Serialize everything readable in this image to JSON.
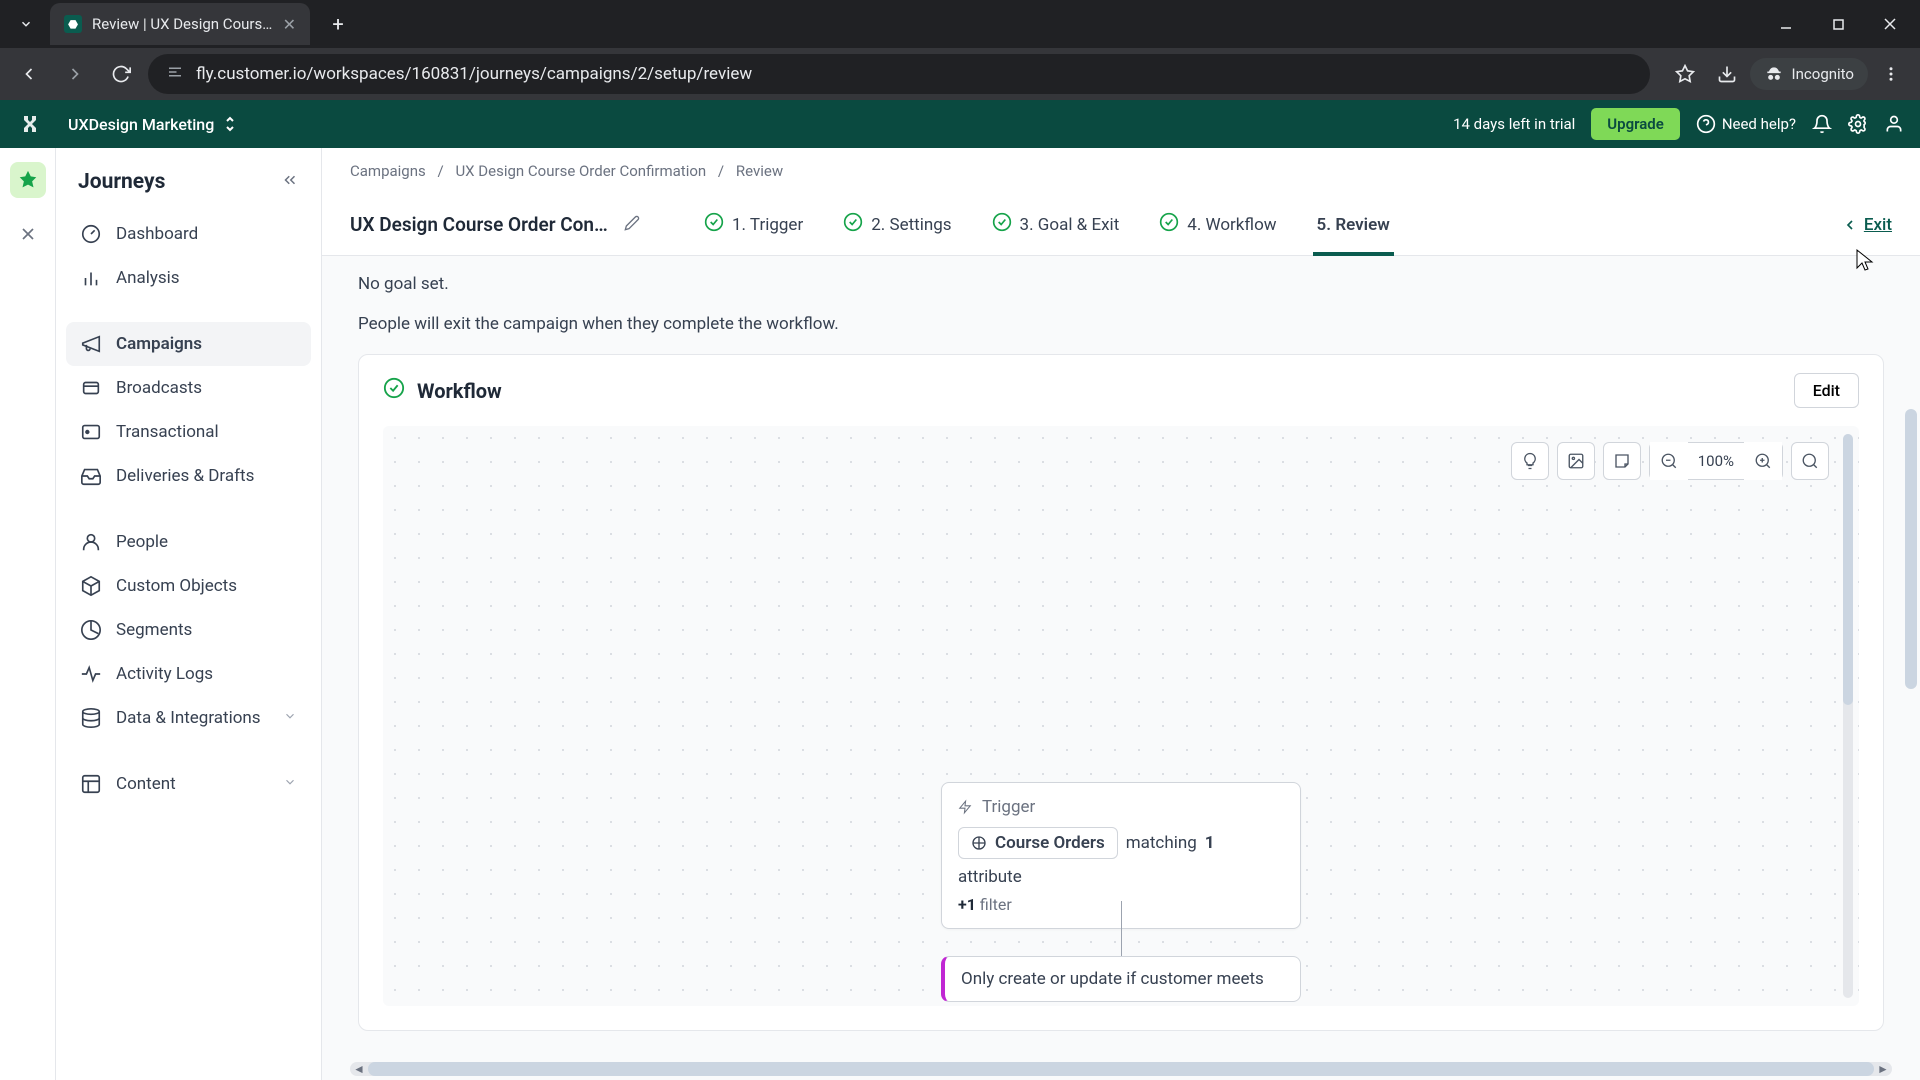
{
  "browser": {
    "tab_title": "Review | UX Design Course Ord",
    "url": "fly.customer.io/workspaces/160831/journeys/campaigns/2/setup/review",
    "incognito": "Incognito"
  },
  "topbar": {
    "workspace": "UXDesign Marketing",
    "trial": "14 days left in trial",
    "upgrade": "Upgrade",
    "help": "Need help?"
  },
  "sidebar": {
    "title": "Journeys",
    "items": [
      {
        "label": "Dashboard"
      },
      {
        "label": "Analysis"
      },
      {
        "label": "Campaigns"
      },
      {
        "label": "Broadcasts"
      },
      {
        "label": "Transactional"
      },
      {
        "label": "Deliveries & Drafts"
      },
      {
        "label": "People"
      },
      {
        "label": "Custom Objects"
      },
      {
        "label": "Segments"
      },
      {
        "label": "Activity Logs"
      },
      {
        "label": "Data & Integrations"
      },
      {
        "label": "Content"
      }
    ]
  },
  "breadcrumb": {
    "a": "Campaigns",
    "b": "UX Design Course Order Confirmation",
    "c": "Review"
  },
  "steps": {
    "title": "UX Design Course Order Confi...",
    "s1": "1. Trigger",
    "s2": "2. Settings",
    "s3": "3. Goal & Exit",
    "s4": "4. Workflow",
    "s5": "5. Review",
    "exit": "Exit"
  },
  "review": {
    "no_goal": "No goal set.",
    "exit_msg": "People will exit the campaign when they complete the workflow.",
    "workflow_title": "Workflow",
    "edit": "Edit",
    "zoom": "100%",
    "trigger_label": "Trigger",
    "object_name": "Course Orders",
    "matching": "matching",
    "attr_count": "1",
    "attribute": "attribute",
    "filter_prefix": "+1",
    "filter_word": "filter",
    "next_node": "Only create or update if customer meets"
  }
}
